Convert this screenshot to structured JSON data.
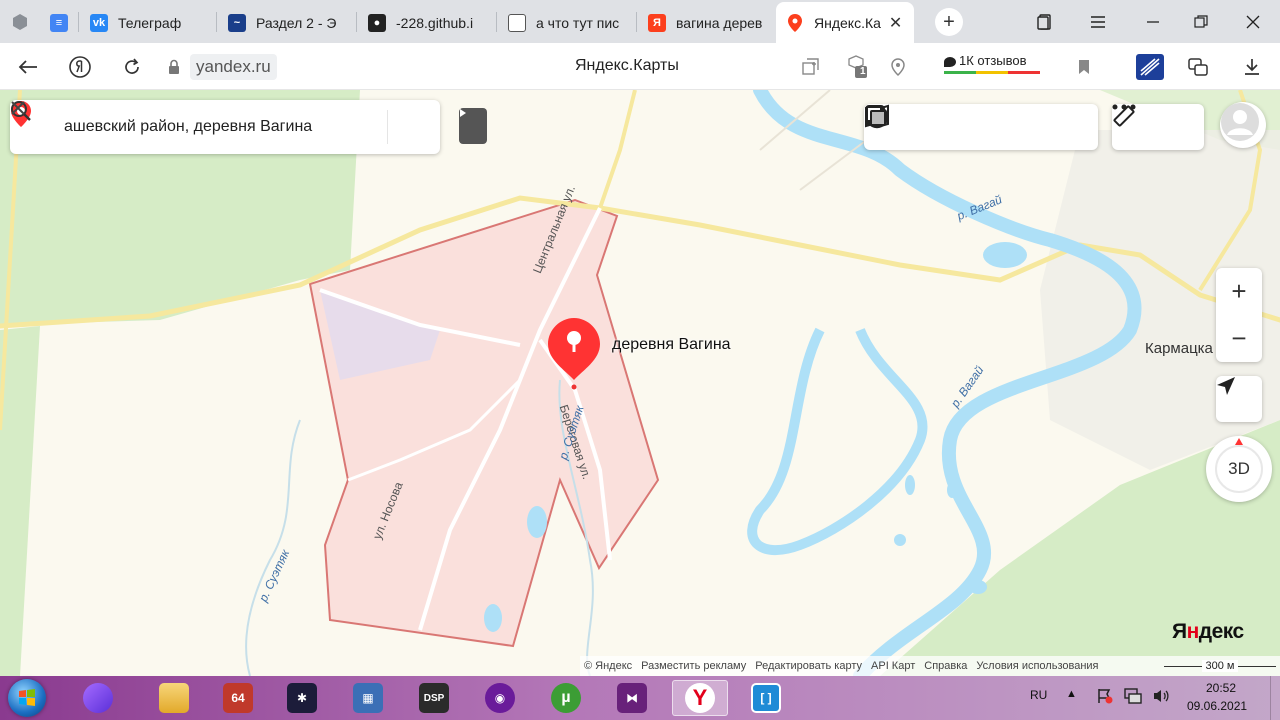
{
  "browser": {
    "tabs": [
      {
        "title": "",
        "icon": "docs-icon",
        "color": "#4285f4"
      },
      {
        "title": "Телеграф",
        "icon": "vk-icon",
        "color": "#2787f5"
      },
      {
        "title": "Раздел 2 - Э",
        "icon": "comet-icon",
        "color": "#1a3e8a"
      },
      {
        "title": "-228.github.i",
        "icon": "github-icon",
        "color": "#222222"
      },
      {
        "title": "а что тут пис",
        "icon": "document-icon",
        "color": "#555555"
      },
      {
        "title": "вагина дерев",
        "icon": "yandex-icon",
        "color": "#fc3f1d"
      },
      {
        "title": "Яндекс.Ка",
        "icon": "yandex-maps-icon",
        "color": "#fc3f1d",
        "active": true
      }
    ],
    "close_glyph": "✕",
    "new_tab_glyph": "+",
    "url_domain": "yandex.ru",
    "page_title": "Яндекс.Карты",
    "reviews_label": "1К отзывов",
    "badge_count": "1"
  },
  "map": {
    "search_query": "ашевский район, деревня Вагина",
    "place_label": "деревня Вагина",
    "nearby_label": "Кармацка",
    "streets": {
      "central": "Центральная ул.",
      "shore": "Береговая ул.",
      "nosova": "ул. Носова"
    },
    "rivers": {
      "vagay_1": "р. Вагай",
      "vagay_2": "р. Вагай",
      "suetyak_1": "р. Суэтяк",
      "suetyak_2": "р. Суэтяк"
    },
    "zoom_in": "+",
    "zoom_out": "−",
    "mode_3d": "3D",
    "logo_black_1": "Я",
    "logo_red": "н",
    "logo_black_2": "декс",
    "footer_links": [
      "© Яндекс",
      "Разместить рекламу",
      "Редактировать карту",
      "API Карт",
      "Справка",
      "Условия использования"
    ],
    "scale_label": "300 м",
    "colors": {
      "land": "#fbf9ef",
      "forest": "#d6ecc6",
      "water": "#aee0f7",
      "road": "#f6e89e",
      "boundary": "#d97774",
      "boundary_fill": "#f9dcd8",
      "marker": "#f33"
    }
  },
  "taskbar": {
    "apps": [
      {
        "name": "alice-app",
        "label": "",
        "color": "#7b3fe4"
      },
      {
        "name": "file-explorer-app",
        "label": "",
        "color": "#f2c14e"
      },
      {
        "name": "aida64-app",
        "label": "64",
        "color": "#c0392b"
      },
      {
        "name": "fan-control-app",
        "label": "",
        "color": "#1c1c3a"
      },
      {
        "name": "calculator-app",
        "label": "",
        "color": "#3b6fb6"
      },
      {
        "name": "dsp-app",
        "label": "DSP",
        "color": "#2b2b2b"
      },
      {
        "name": "media-app",
        "label": "",
        "color": "#6a1b9a"
      },
      {
        "name": "utorrent-app",
        "label": "µ",
        "color": "#3c9d35"
      },
      {
        "name": "visual-studio-app",
        "label": "",
        "color": "#68217a"
      },
      {
        "name": "yandex-browser-app",
        "label": "Y",
        "color": "#ffffff",
        "active": true
      },
      {
        "name": "window-app",
        "label": "",
        "color": "#1f8bd6"
      }
    ],
    "lang": "RU",
    "time": "20:52",
    "date": "09.06.2021"
  }
}
